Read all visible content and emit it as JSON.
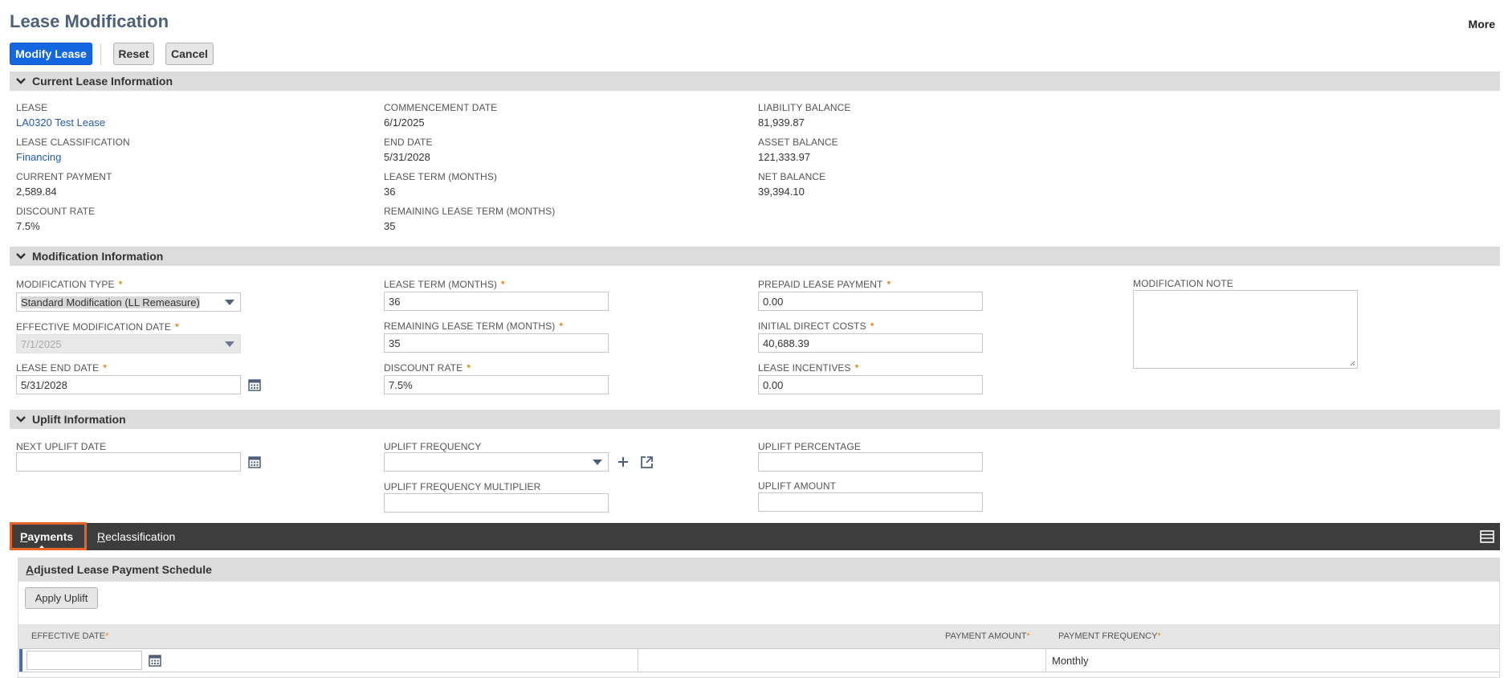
{
  "page": {
    "title": "Lease Modification",
    "more": "More"
  },
  "toolbar": {
    "modify": "Modify Lease",
    "reset": "Reset",
    "cancel": "Cancel"
  },
  "current": {
    "title": "Current Lease Information",
    "lease_label": "LEASE",
    "lease_value": "LA0320 Test Lease",
    "classification_label": "LEASE CLASSIFICATION",
    "classification_value": "Financing",
    "payment_label": "CURRENT PAYMENT",
    "payment_value": "2,589.84",
    "discount_label": "DISCOUNT RATE",
    "discount_value": "7.5%",
    "commencement_label": "COMMENCEMENT DATE",
    "commencement_value": "6/1/2025",
    "end_label": "END DATE",
    "end_value": "5/31/2028",
    "term_label": "LEASE TERM (MONTHS)",
    "term_value": "36",
    "remaining_label": "REMAINING LEASE TERM (MONTHS)",
    "remaining_value": "35",
    "liability_label": "LIABILITY BALANCE",
    "liability_value": "81,939.87",
    "asset_label": "ASSET BALANCE",
    "asset_value": "121,333.97",
    "net_label": "NET BALANCE",
    "net_value": "39,394.10"
  },
  "modification": {
    "title": "Modification Information",
    "type_label": "MODIFICATION TYPE",
    "type_value": "Standard Modification (LL Remeasure)",
    "eff_date_label": "EFFECTIVE MODIFICATION DATE",
    "eff_date_value": "7/1/2025",
    "end_date_label": "LEASE END DATE",
    "end_date_value": "5/31/2028",
    "term_label": "LEASE TERM (MONTHS)",
    "term_value": "36",
    "remaining_label": "REMAINING LEASE TERM (MONTHS)",
    "remaining_value": "35",
    "discount_label": "DISCOUNT RATE",
    "discount_value": "7.5%",
    "prepaid_label": "PREPAID LEASE PAYMENT",
    "prepaid_value": "0.00",
    "idc_label": "INITIAL DIRECT COSTS",
    "idc_value": "40,688.39",
    "incentives_label": "LEASE INCENTIVES",
    "incentives_value": "0.00",
    "note_label": "MODIFICATION NOTE"
  },
  "uplift": {
    "title": "Uplift Information",
    "next_date_label": "NEXT UPLIFT DATE",
    "frequency_label": "UPLIFT FREQUENCY",
    "multiplier_label": "UPLIFT FREQUENCY MULTIPLIER",
    "percentage_label": "UPLIFT PERCENTAGE",
    "amount_label": "UPLIFT AMOUNT"
  },
  "tabs": {
    "payments": "ayments",
    "payments_key": "P",
    "reclass": "eclassification",
    "reclass_key": "R"
  },
  "schedule": {
    "title_key": "A",
    "title": "djusted Lease Payment Schedule",
    "apply_button": "Apply Uplift",
    "col_effective": "EFFECTIVE DATE",
    "col_amount": "PAYMENT AMOUNT",
    "col_frequency": "PAYMENT FREQUENCY",
    "row_frequency": "Monthly"
  },
  "colors": {
    "accent": "#1467e0",
    "brand": "#4d5f79",
    "required": "#e28a19",
    "highlight": "#e8632a"
  }
}
